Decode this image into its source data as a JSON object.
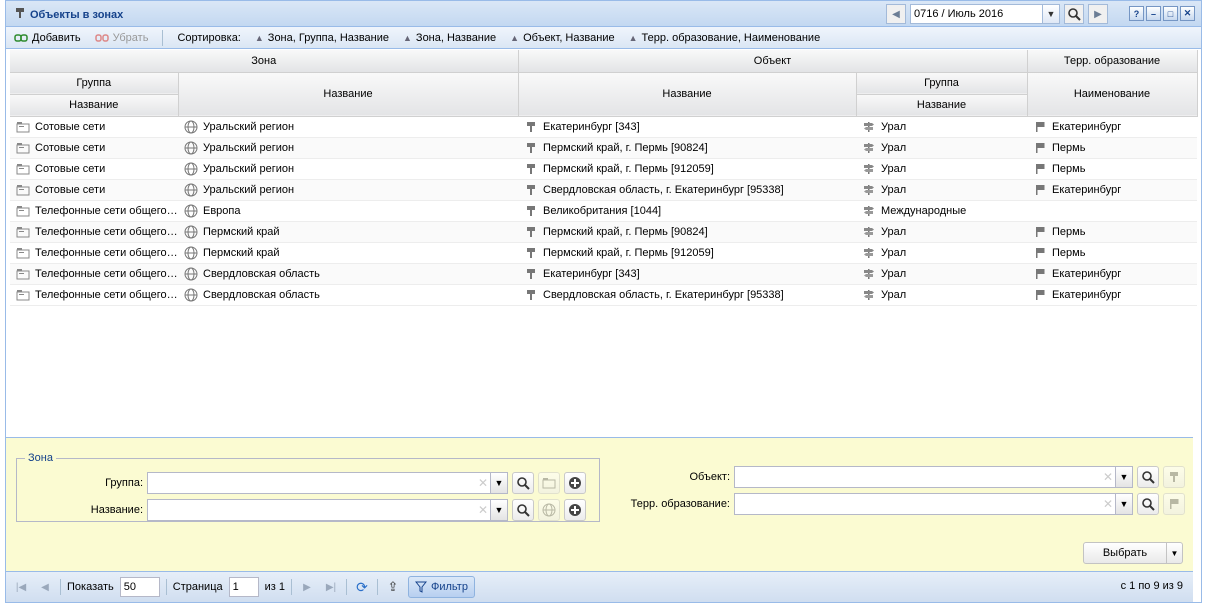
{
  "window": {
    "title": "Объекты в зонах"
  },
  "period": {
    "value": "0716 / Июль 2016"
  },
  "toolbar": {
    "add_label": "Добавить",
    "remove_label": "Убрать",
    "sort_label": "Сортировка:",
    "sorts": [
      "Зона, Группа, Название",
      "Зона, Название",
      "Объект, Название",
      "Терр. образование, Наименование"
    ]
  },
  "headers": {
    "zone": "Зона",
    "object": "Объект",
    "terr": "Терр. образование",
    "zone_group": "Группа",
    "zone_group_name": "Название",
    "zone_name": "Название",
    "object_name": "Название",
    "object_group": "Группа",
    "object_group_name": "Название",
    "terr_name": "Наименование"
  },
  "rows": [
    {
      "zone_group": "Сотовые сети",
      "zone_name": "Уральский регион",
      "object": "Екатеринбург [343]",
      "group": "Урал",
      "terr": "Екатеринбург"
    },
    {
      "zone_group": "Сотовые сети",
      "zone_name": "Уральский регион",
      "object": "Пермский край, г. Пермь [90824]",
      "group": "Урал",
      "terr": "Пермь"
    },
    {
      "zone_group": "Сотовые сети",
      "zone_name": "Уральский регион",
      "object": "Пермский край, г. Пермь [912059]",
      "group": "Урал",
      "terr": "Пермь"
    },
    {
      "zone_group": "Сотовые сети",
      "zone_name": "Уральский регион",
      "object": "Свердловская область, г. Екатеринбург [95338]",
      "group": "Урал",
      "terr": "Екатеринбург"
    },
    {
      "zone_group": "Телефонные сети общего пользования",
      "zone_name": "Европа",
      "object": "Великобритания [1044]",
      "group": "Международные",
      "terr": ""
    },
    {
      "zone_group": "Телефонные сети общего пользования",
      "zone_name": "Пермский край",
      "object": "Пермский край, г. Пермь [90824]",
      "group": "Урал",
      "terr": "Пермь"
    },
    {
      "zone_group": "Телефонные сети общего пользования",
      "zone_name": "Пермский край",
      "object": "Пермский край, г. Пермь [912059]",
      "group": "Урал",
      "terr": "Пермь"
    },
    {
      "zone_group": "Телефонные сети общего пользования",
      "zone_name": "Свердловская область",
      "object": "Екатеринбург [343]",
      "group": "Урал",
      "terr": "Екатеринбург"
    },
    {
      "zone_group": "Телефонные сети общего пользования",
      "zone_name": "Свердловская область",
      "object": "Свердловская область, г. Екатеринбург [95338]",
      "group": "Урал",
      "terr": "Екатеринбург"
    }
  ],
  "filter": {
    "legend": "Зона",
    "group_label": "Группа:",
    "name_label": "Название:",
    "object_label": "Объект:",
    "terr_label": "Терр. образование:",
    "choose_label": "Выбрать"
  },
  "pager": {
    "show_label": "Показать",
    "page_size": "50",
    "page_label": "Страница",
    "page": "1",
    "of_label": "из 1",
    "filter_label": "Фильтр",
    "info": "с 1 по 9 из 9"
  }
}
